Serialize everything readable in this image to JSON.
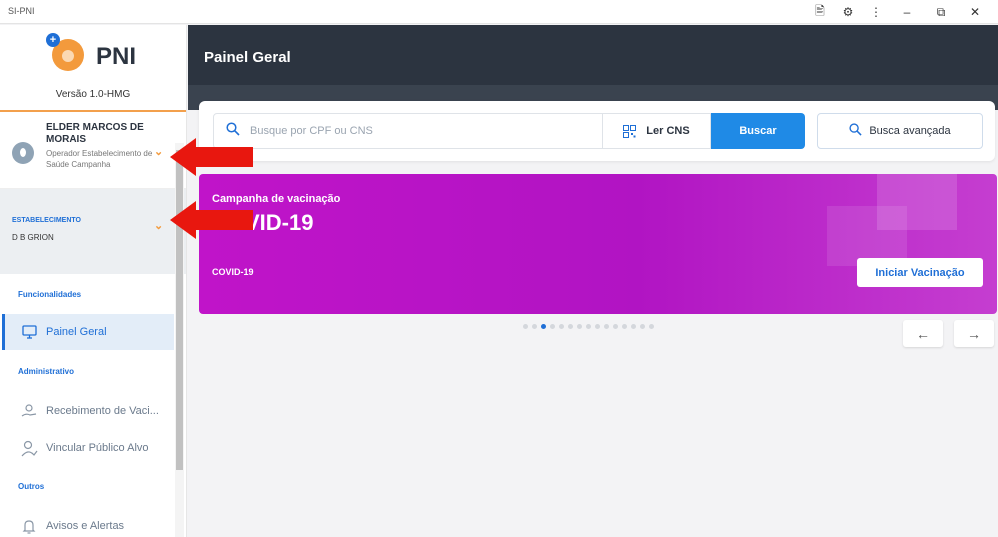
{
  "window": {
    "title": "SI-PNI"
  },
  "sidebar": {
    "logo_text": "PNI",
    "logo_plus": "+",
    "version": "Versão 1.0-HMG",
    "user": {
      "name": "ELDER MARCOS DE MORAIS",
      "role": "Operador Estabelecimento de Saúde Campanha"
    },
    "establishment": {
      "label": "ESTABELECIMENTO",
      "value": "D B GRION"
    },
    "sections": {
      "funcionalidades": "Funcionalidades",
      "administrativo": "Administrativo",
      "outros": "Outros"
    },
    "items": {
      "painel_geral": "Painel Geral",
      "recebimento": "Recebimento de Vaci...",
      "vincular": "Vincular Público Alvo",
      "avisos": "Avisos e Alertas"
    }
  },
  "header": {
    "title": "Painel Geral"
  },
  "search": {
    "placeholder": "Busque por CPF ou CNS",
    "ler_cns": "Ler CNS",
    "buscar": "Buscar",
    "busca_avancada": "Busca avançada"
  },
  "banner": {
    "subtitle": "Campanha de vacinação",
    "title": "COVID-19",
    "tag": "COVID-19",
    "button": "Iniciar Vacinação",
    "color": "#b814c5"
  },
  "carousel": {
    "dot_count": 15,
    "active_index": 2
  },
  "colors": {
    "accent": "#1f6fd6",
    "header": "#2c3440",
    "logo": "#f39a3c",
    "annotation": "#e8170f"
  }
}
